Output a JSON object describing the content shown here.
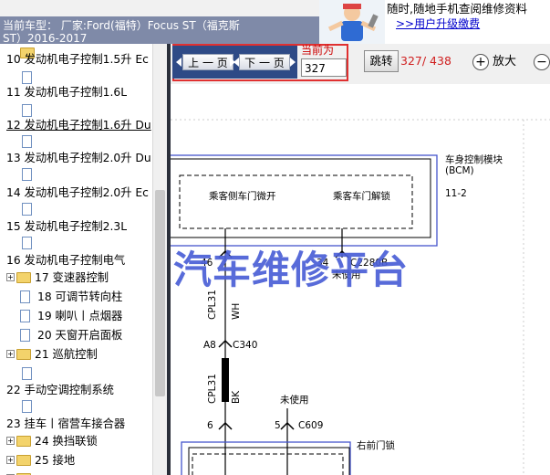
{
  "header": {
    "title_line1": "当前车型： 厂家:Ford(福特）Focus ST（福克斯",
    "title_line2": "ST）2016-2017",
    "promo_line1": "随时,随地手机查阅维修资料",
    "promo_link": ">>用户升级缴费"
  },
  "sidebar": {
    "items": [
      {
        "label": "10 发动机电子控制1.5升 Ec"
      },
      {
        "label": "11 发动机电子控制1.6L"
      },
      {
        "label": "12 发动机电子控制1.6升 Du"
      },
      {
        "label": "13 发动机电子控制2.0升 Du"
      },
      {
        "label": "14 发动机电子控制2.0升 Ec"
      },
      {
        "label": "15 发动机电子控制2.3L"
      },
      {
        "label": "16 发动机电子控制电气"
      },
      {
        "label": "17 变速器控制"
      },
      {
        "label": "18 可调节转向柱"
      },
      {
        "label": "19 喇叭丨点烟器"
      },
      {
        "label": "20 天窗开启面板"
      },
      {
        "label": "21 巡航控制"
      },
      {
        "label": "22 手动空调控制系统"
      },
      {
        "label": "23 挂车丨宿营车接合器"
      },
      {
        "label": "24 换挡联锁"
      },
      {
        "label": "25 接地"
      }
    ]
  },
  "toolbar": {
    "prev_label": "上 一 页",
    "next_label": "下 一 页",
    "current_label": "当前为",
    "page_value": "327",
    "jump_label": "跳转",
    "page_count": "327/ 438",
    "zoom_in_label": "放大"
  },
  "diagram": {
    "bcm_title": "车身控制模块",
    "bcm_abbr": "(BCM)",
    "bcm_ref": "11-2",
    "unlock_left": "乘客侧车门微开",
    "unlock_right": "乘客车门解锁",
    "pin46": "46",
    "pin34": "34",
    "conn_c2280b": "C2280B",
    "unused1": "未使用",
    "wire1": "CPL31",
    "wire1_color": "WH",
    "a8": "A8",
    "c340": "C340",
    "wire2": "CPL31",
    "wire2_color": "BK",
    "unused2": "未使用",
    "pin6": "6",
    "pin5": "5",
    "c609": "C609",
    "front_door_lock": "右前门锁",
    "watermark": "汽车维修平台"
  },
  "colors": {
    "nav_blue": "#2e4a86",
    "highlight_red": "#e03030",
    "watermark_blue": "#4a5fd6",
    "bcm_border": "#4455cc"
  }
}
